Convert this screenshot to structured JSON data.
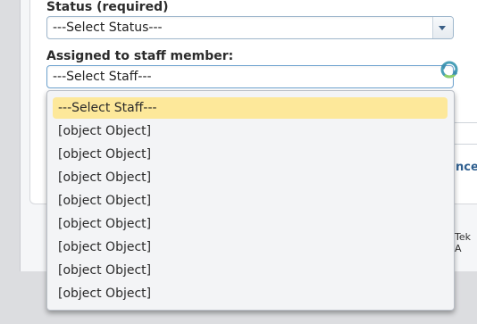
{
  "form": {
    "status_label": "Status (required)",
    "status_value": "---Select Status---",
    "staff_label": "Assigned to staff member:",
    "staff_value": "---Select Staff---"
  },
  "dropdown": {
    "options": [
      "---Select Staff---",
      "[object Object]",
      "[object Object]",
      "[object Object]",
      "[object Object]",
      "[object Object]",
      "[object Object]",
      "[object Object]",
      "[object Object]"
    ],
    "selected_index": 0
  },
  "background": {
    "link_fragment": "nce",
    "footer_fragment": "Tek A"
  },
  "colors": {
    "highlight": "#fde89a",
    "link": "#2f5f8f",
    "select_border": "#9fb7cc"
  },
  "icons": {
    "refresh": "refresh-icon",
    "dropdown_arrow": "chevron-down-icon"
  }
}
